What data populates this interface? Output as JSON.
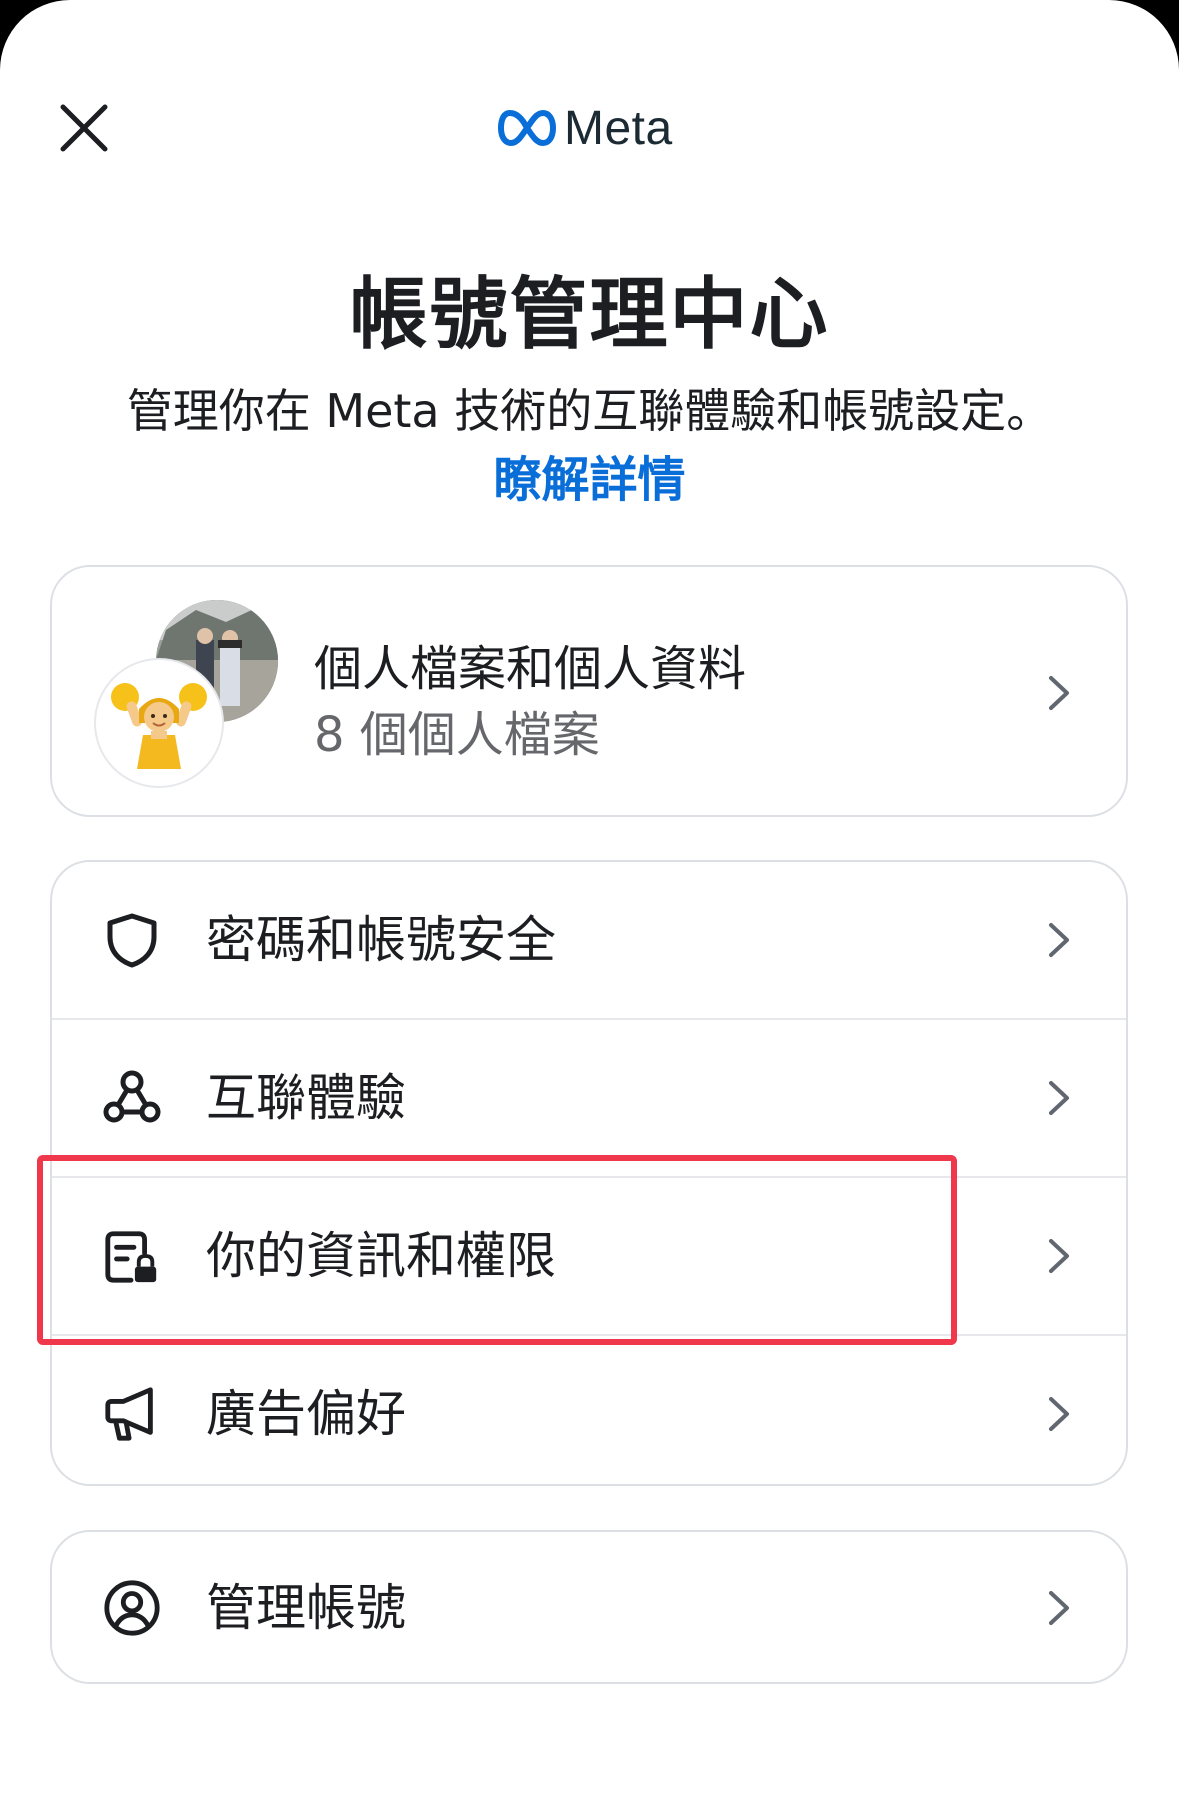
{
  "header": {
    "close_icon": "close-icon",
    "brand": "Meta",
    "brand_color": "#0a6ed8"
  },
  "page": {
    "title": "帳號管理中心",
    "subtitle": "管理你在 Meta 技術的互聯體驗和帳號設定。",
    "learn_more": "瞭解詳情",
    "link_color": "#0a6ed8"
  },
  "profiles_card": {
    "title": "個人檔案和個人資料",
    "subtitle": "8 個個人檔案"
  },
  "settings": [
    {
      "id": "security",
      "icon": "shield-icon",
      "label": "密碼和帳號安全"
    },
    {
      "id": "connected",
      "icon": "connected-nodes-icon",
      "label": "互聯體驗"
    },
    {
      "id": "info",
      "icon": "document-lock-icon",
      "label": "你的資訊和權限"
    },
    {
      "id": "ads",
      "icon": "megaphone-icon",
      "label": "廣告偏好"
    }
  ],
  "manage": {
    "icon": "person-circle-icon",
    "label": "管理帳號"
  },
  "highlight_color": "#f0384d"
}
